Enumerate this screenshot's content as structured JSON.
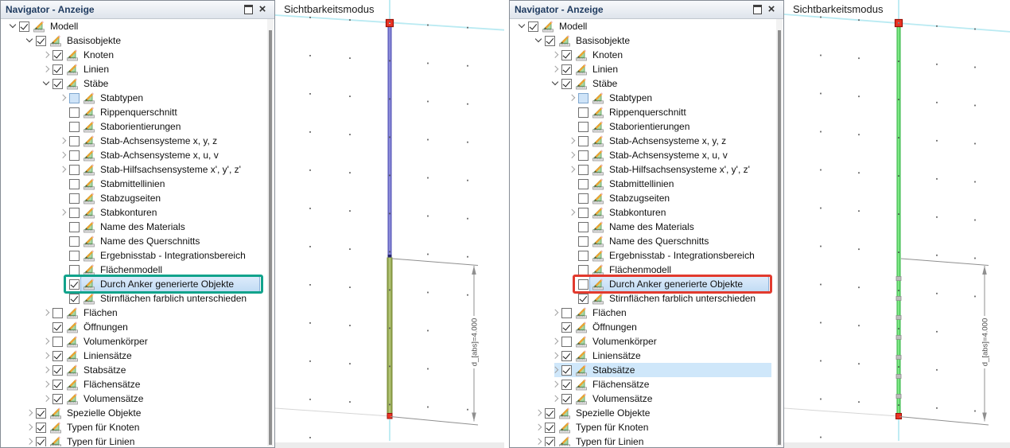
{
  "icons": {
    "tree_item_icon": "display-icon (set-square with pencil and ruler)",
    "titlebar_icons": [
      "float-window-icon",
      "close-icon"
    ],
    "expand_icons": [
      "chevron-down-icon",
      "chevron-right-icon"
    ]
  },
  "panels": [
    {
      "side": "left",
      "navigator": {
        "title": "Navigator - Anzeige"
      },
      "viewport": {
        "label": "Sichtbarkeitsmodus",
        "dimension_label": "d_[abs]=4.000",
        "member_style": "blue-olive",
        "colors": {
          "member_top_edge": "#4343ad",
          "member_top_center": "#9b9be2",
          "member_bottom_edge": "#6f8129",
          "member_bottom_center": "#bcce80",
          "junction_cap": "#23236e",
          "node": "#ea3425",
          "node_border": "#9a1207",
          "grid_axis": "#b9eaf2",
          "grid_faint": "#d6d6d6",
          "dimension": "#8f8f8f",
          "dimension_text": "#4c4c4c"
        }
      },
      "tree": [
        {
          "label": "Modell",
          "level": 0,
          "arrow": "expanded",
          "checkbox": "checked"
        },
        {
          "label": "Basisobjekte",
          "level": 1,
          "arrow": "expanded",
          "checkbox": "checked"
        },
        {
          "label": "Knoten",
          "level": 2,
          "arrow": "collapsed",
          "checkbox": "checked"
        },
        {
          "label": "Linien",
          "level": 2,
          "arrow": "collapsed",
          "checkbox": "checked"
        },
        {
          "label": "Stäbe",
          "level": 2,
          "arrow": "expanded",
          "checkbox": "checked"
        },
        {
          "label": "Stabtypen",
          "level": 3,
          "arrow": "collapsed",
          "checkbox": "partial"
        },
        {
          "label": "Rippenquerschnitt",
          "level": 3,
          "arrow": null,
          "checkbox": "unchecked"
        },
        {
          "label": "Staborientierungen",
          "level": 3,
          "arrow": null,
          "checkbox": "unchecked"
        },
        {
          "label": "Stab-Achsensysteme x, y, z",
          "level": 3,
          "arrow": "collapsed",
          "checkbox": "unchecked"
        },
        {
          "label": "Stab-Achsensysteme x, u, v",
          "level": 3,
          "arrow": "collapsed",
          "checkbox": "unchecked"
        },
        {
          "label": "Stab-Hilfsachsensysteme x', y', z'",
          "level": 3,
          "arrow": "collapsed",
          "checkbox": "unchecked"
        },
        {
          "label": "Stabmittellinien",
          "level": 3,
          "arrow": null,
          "checkbox": "unchecked"
        },
        {
          "label": "Stabzugseiten",
          "level": 3,
          "arrow": null,
          "checkbox": "unchecked"
        },
        {
          "label": "Stabkonturen",
          "level": 3,
          "arrow": "collapsed",
          "checkbox": "unchecked"
        },
        {
          "label": "Name des Materials",
          "level": 3,
          "arrow": null,
          "checkbox": "unchecked"
        },
        {
          "label": "Name des Querschnitts",
          "level": 3,
          "arrow": null,
          "checkbox": "unchecked"
        },
        {
          "label": "Ergebnisstab - Integrationsbereich",
          "level": 3,
          "arrow": null,
          "checkbox": "unchecked"
        },
        {
          "label": "Flächenmodell",
          "level": 3,
          "arrow": null,
          "checkbox": "unchecked"
        },
        {
          "label": "Durch Anker generierte Objekte",
          "level": 3,
          "arrow": null,
          "checkbox": "checked",
          "selected": true,
          "box": "#12a38c"
        },
        {
          "label": "Stirnflächen farblich unterschieden",
          "level": 3,
          "arrow": null,
          "checkbox": "checked"
        },
        {
          "label": "Flächen",
          "level": 2,
          "arrow": "collapsed",
          "checkbox": "unchecked"
        },
        {
          "label": "Öffnungen",
          "level": 2,
          "arrow": null,
          "checkbox": "checked"
        },
        {
          "label": "Volumenkörper",
          "level": 2,
          "arrow": "collapsed",
          "checkbox": "unchecked"
        },
        {
          "label": "Liniensätze",
          "level": 2,
          "arrow": "collapsed",
          "checkbox": "checked"
        },
        {
          "label": "Stabsätze",
          "level": 2,
          "arrow": "collapsed",
          "checkbox": "checked"
        },
        {
          "label": "Flächensätze",
          "level": 2,
          "arrow": "collapsed",
          "checkbox": "checked"
        },
        {
          "label": "Volumensätze",
          "level": 2,
          "arrow": "collapsed",
          "checkbox": "checked"
        },
        {
          "label": "Spezielle Objekte",
          "level": 1,
          "arrow": "collapsed",
          "checkbox": "checked"
        },
        {
          "label": "Typen für Knoten",
          "level": 1,
          "arrow": "collapsed",
          "checkbox": "checked"
        },
        {
          "label": "Typen für Linien",
          "level": 1,
          "arrow": "collapsed",
          "checkbox": "checked"
        }
      ]
    },
    {
      "side": "right",
      "navigator": {
        "title": "Navigator - Anzeige"
      },
      "viewport": {
        "label": "Sichtbarkeitsmodus",
        "dimension_label": "d_[abs]=4.000",
        "member_style": "green-with-nodes",
        "colors": {
          "member_edge": "#27ae3a",
          "member_center": "#90f295",
          "intermediate_node": "#bcbcbc",
          "intermediate_node_border": "#8d8d8d",
          "node": "#ea3425",
          "node_border": "#9a1207",
          "grid_axis": "#b9eaf2",
          "grid_faint": "#d6d6d6",
          "dimension": "#8f8f8f",
          "dimension_text": "#4c4c4c"
        }
      },
      "tree": [
        {
          "label": "Modell",
          "level": 0,
          "arrow": "expanded",
          "checkbox": "checked"
        },
        {
          "label": "Basisobjekte",
          "level": 1,
          "arrow": "expanded",
          "checkbox": "checked"
        },
        {
          "label": "Knoten",
          "level": 2,
          "arrow": "collapsed",
          "checkbox": "checked"
        },
        {
          "label": "Linien",
          "level": 2,
          "arrow": "collapsed",
          "checkbox": "checked"
        },
        {
          "label": "Stäbe",
          "level": 2,
          "arrow": "expanded",
          "checkbox": "checked"
        },
        {
          "label": "Stabtypen",
          "level": 3,
          "arrow": "collapsed",
          "checkbox": "partial"
        },
        {
          "label": "Rippenquerschnitt",
          "level": 3,
          "arrow": null,
          "checkbox": "unchecked"
        },
        {
          "label": "Staborientierungen",
          "level": 3,
          "arrow": null,
          "checkbox": "unchecked"
        },
        {
          "label": "Stab-Achsensysteme x, y, z",
          "level": 3,
          "arrow": "collapsed",
          "checkbox": "unchecked"
        },
        {
          "label": "Stab-Achsensysteme x, u, v",
          "level": 3,
          "arrow": "collapsed",
          "checkbox": "unchecked"
        },
        {
          "label": "Stab-Hilfsachsensysteme x', y', z'",
          "level": 3,
          "arrow": "collapsed",
          "checkbox": "unchecked"
        },
        {
          "label": "Stabmittellinien",
          "level": 3,
          "arrow": null,
          "checkbox": "unchecked"
        },
        {
          "label": "Stabzugseiten",
          "level": 3,
          "arrow": null,
          "checkbox": "unchecked"
        },
        {
          "label": "Stabkonturen",
          "level": 3,
          "arrow": "collapsed",
          "checkbox": "unchecked"
        },
        {
          "label": "Name des Materials",
          "level": 3,
          "arrow": null,
          "checkbox": "unchecked"
        },
        {
          "label": "Name des Querschnitts",
          "level": 3,
          "arrow": null,
          "checkbox": "unchecked"
        },
        {
          "label": "Ergebnisstab - Integrationsbereich",
          "level": 3,
          "arrow": null,
          "checkbox": "unchecked"
        },
        {
          "label": "Flächenmodell",
          "level": 3,
          "arrow": null,
          "checkbox": "unchecked"
        },
        {
          "label": "Durch Anker generierte Objekte",
          "level": 3,
          "arrow": null,
          "checkbox": "unchecked",
          "selected": true,
          "box": "#e23a2e"
        },
        {
          "label": "Stirnflächen farblich unterschieden",
          "level": 3,
          "arrow": null,
          "checkbox": "checked"
        },
        {
          "label": "Flächen",
          "level": 2,
          "arrow": "collapsed",
          "checkbox": "unchecked"
        },
        {
          "label": "Öffnungen",
          "level": 2,
          "arrow": null,
          "checkbox": "checked"
        },
        {
          "label": "Volumenkörper",
          "level": 2,
          "arrow": "collapsed",
          "checkbox": "unchecked"
        },
        {
          "label": "Liniensätze",
          "level": 2,
          "arrow": "collapsed",
          "checkbox": "checked"
        },
        {
          "label": "Stabsätze",
          "level": 2,
          "arrow": "collapsed",
          "checkbox": "checked",
          "flat": true
        },
        {
          "label": "Flächensätze",
          "level": 2,
          "arrow": "collapsed",
          "checkbox": "checked"
        },
        {
          "label": "Volumensätze",
          "level": 2,
          "arrow": "collapsed",
          "checkbox": "checked"
        },
        {
          "label": "Spezielle Objekte",
          "level": 1,
          "arrow": "collapsed",
          "checkbox": "checked"
        },
        {
          "label": "Typen für Knoten",
          "level": 1,
          "arrow": "collapsed",
          "checkbox": "checked"
        },
        {
          "label": "Typen für Linien",
          "level": 1,
          "arrow": "collapsed",
          "checkbox": "checked"
        }
      ]
    }
  ]
}
